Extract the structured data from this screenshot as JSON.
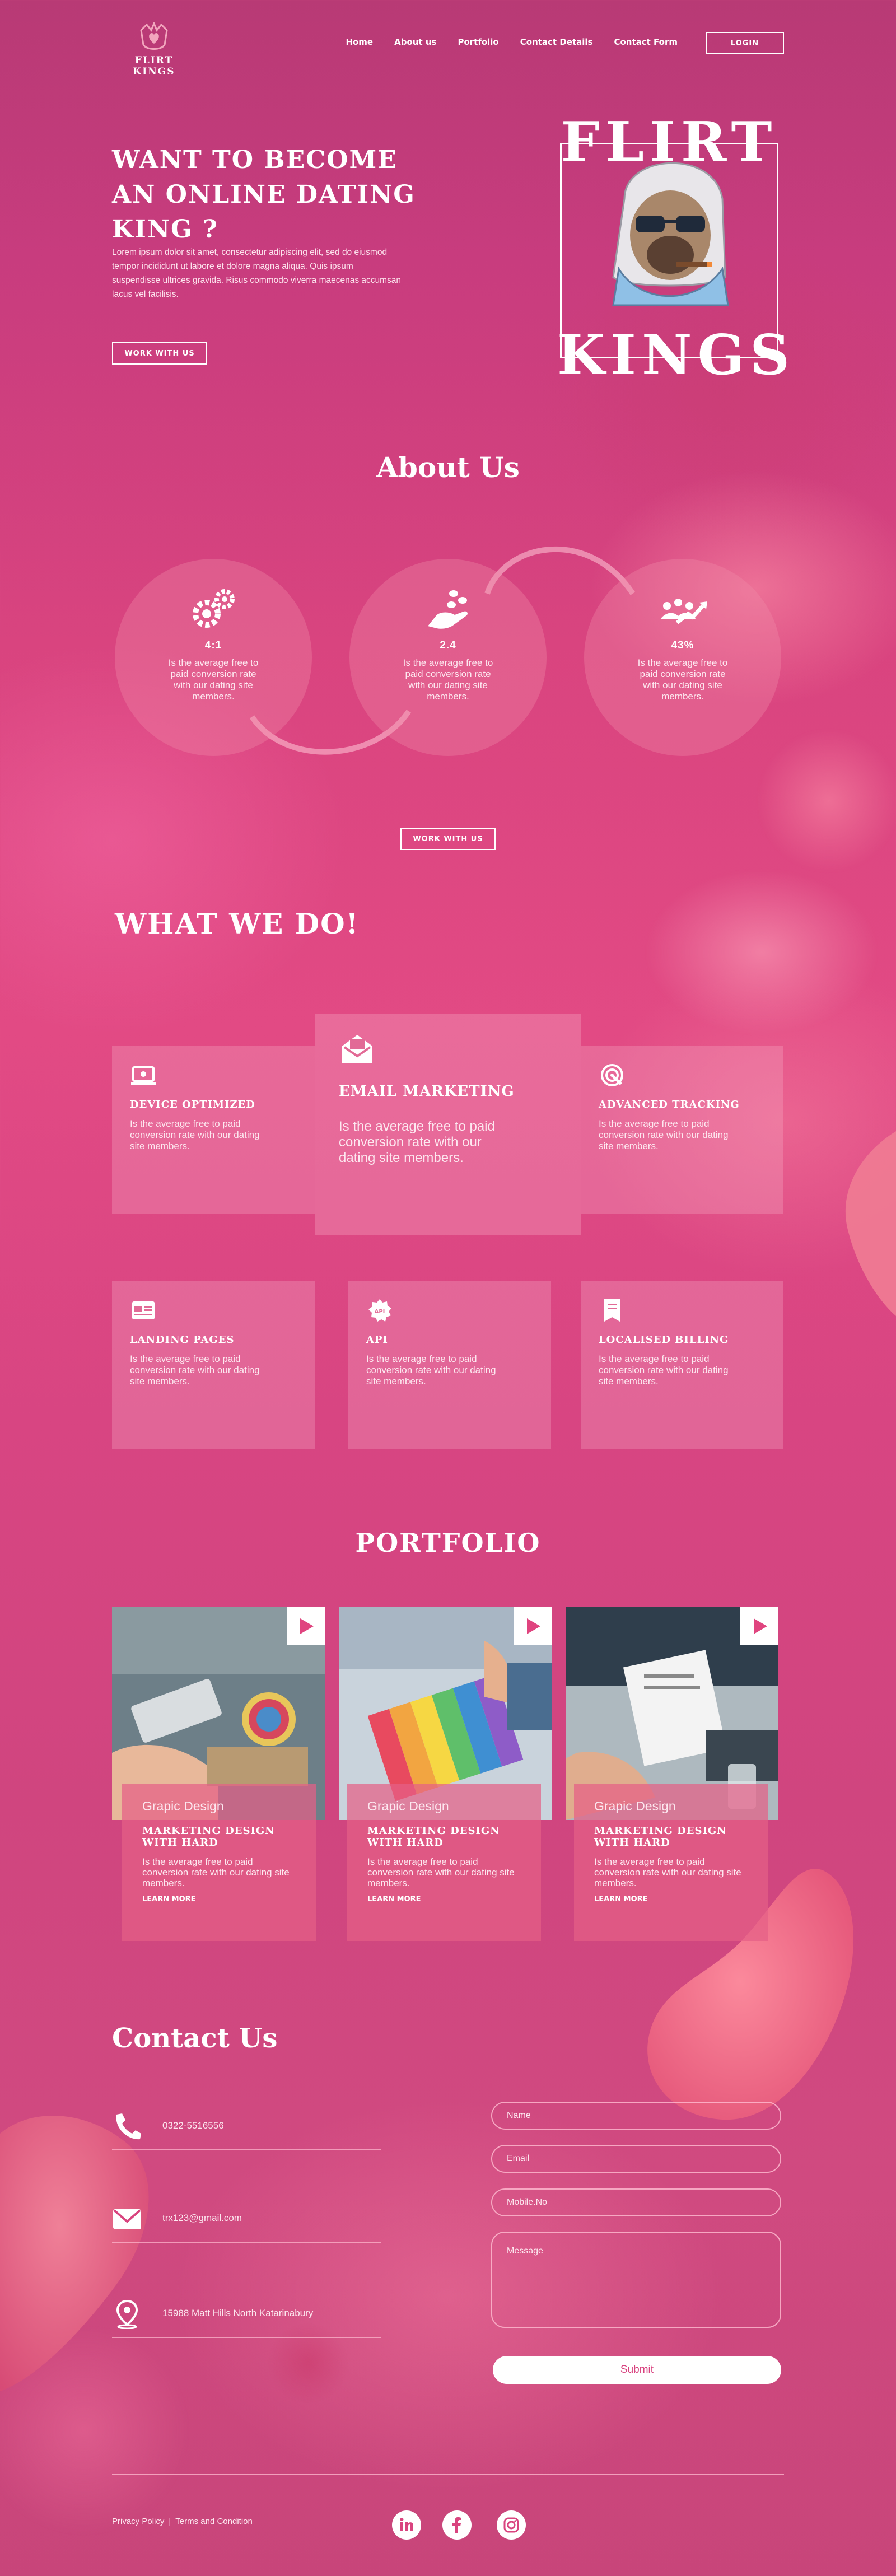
{
  "brand": {
    "name": "FLIRT KINGS"
  },
  "nav": {
    "items": [
      "Home",
      "About us",
      "Portfolio",
      "Contact Details",
      "Contact Form"
    ],
    "login_label": "LOGIN"
  },
  "hero": {
    "title": "WANT TO BECOME AN ONLINE DATING KING ?",
    "text": "Lorem ipsum dolor sit amet, consectetur adipiscing elit, sed do eiusmod tempor incididunt ut labore et dolore magna aliqua. Quis ipsum suspendisse ultrices gravida. Risus commodo viverra maecenas accumsan lacus vel facilisis.",
    "button": "WORK WITH US",
    "art_top": "FLIRT",
    "art_bottom": "KINGS"
  },
  "about": {
    "title": "About Us",
    "stats": [
      {
        "icon": "gears-icon",
        "value": "4:1",
        "text": "Is the average free to paid conversion rate with our dating site members."
      },
      {
        "icon": "hand-coins-icon",
        "value": "2.4",
        "text": "Is the average free to paid conversion rate with our dating site members."
      },
      {
        "icon": "growth-chart-icon",
        "value": "43%",
        "text": "Is the average free to paid conversion rate with our dating site members."
      }
    ],
    "button": "WORK WITH US"
  },
  "services": {
    "title": "WHAT WE DO!",
    "items": [
      {
        "icon": "device-icon",
        "title": "DEVICE OPTIMIZED",
        "text": "Is the average free to paid conversion rate with our dating site members."
      },
      {
        "icon": "email-icon",
        "title": "EMAIL MARKETING",
        "text": "Is the average free to paid conversion rate with our dating site members."
      },
      {
        "icon": "tracking-icon",
        "title": "ADVANCED TRACKING",
        "text": "Is the average free to paid conversion rate with our dating site members."
      },
      {
        "icon": "landing-page-icon",
        "title": "LANDING PAGES",
        "text": "Is the average free to paid conversion rate with our dating site members."
      },
      {
        "icon": "api-icon",
        "title": "API",
        "text": "Is the average free to paid conversion rate with our dating site members."
      },
      {
        "icon": "billing-icon",
        "title": "LOCALISED BILLING",
        "text": "Is the average free to paid conversion rate with our dating site members."
      }
    ]
  },
  "portfolio": {
    "title": "PORTFOLIO",
    "items": [
      {
        "category": "Grapic Design",
        "title": "MARKETING DESIGN WITH HARD",
        "text": "Is the average free to paid conversion rate with our dating site members.",
        "link": "LEARN MORE"
      },
      {
        "category": "Grapic Design",
        "title": "MARKETING DESIGN WITH HARD",
        "text": "Is the average free to paid conversion rate with our dating site members.",
        "link": "LEARN MORE"
      },
      {
        "category": "Grapic Design",
        "title": "MARKETING DESIGN WITH HARD",
        "text": "Is the average free to paid conversion rate with our dating site members.",
        "link": "LEARN MORE"
      }
    ]
  },
  "contact": {
    "title": "Contact Us",
    "phone": "0322-5516556",
    "email": "trx123@gmail.com",
    "address": "15988 Matt Hills North Katarinabury",
    "form": {
      "name_placeholder": "Name",
      "email_placeholder": "Email",
      "mobile_placeholder": "Mobile.No",
      "message_placeholder": "Message",
      "submit": "Submit"
    }
  },
  "footer": {
    "privacy": "Privacy Policy",
    "separator": "|",
    "terms": "Terms and Condition",
    "social": [
      "linkedin-icon",
      "facebook-icon",
      "instagram-icon"
    ]
  },
  "colors": {
    "accent": "#e0447f",
    "background": "#d9447f",
    "text": "#ffffff"
  }
}
